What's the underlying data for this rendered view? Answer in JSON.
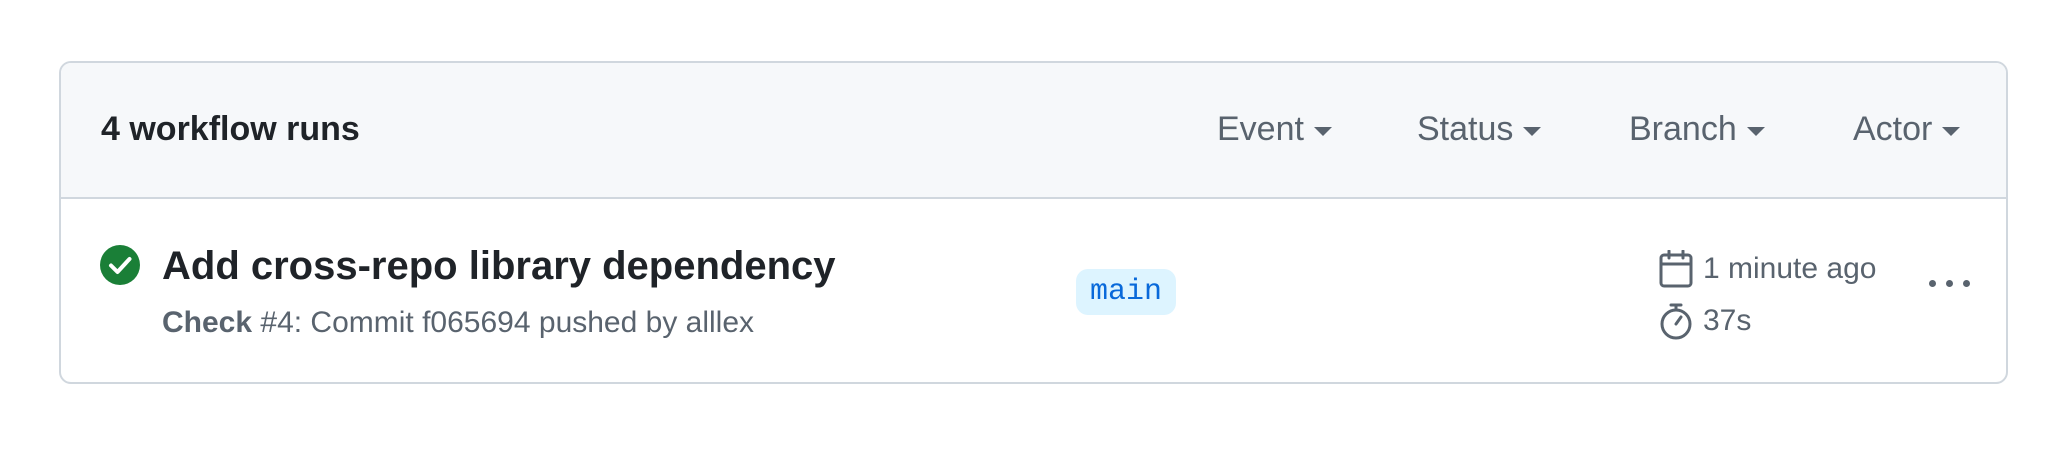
{
  "header": {
    "runs_count": "4 workflow runs",
    "filters": {
      "event": "Event",
      "status": "Status",
      "branch": "Branch",
      "actor": "Actor"
    }
  },
  "runs": [
    {
      "status_icon": "check-circle-icon",
      "status_color": "#1a7f37",
      "title": "Add cross-repo library dependency",
      "workflow_name": "Check",
      "run_number": "#4",
      "description": ": Commit f065694 pushed by alllex",
      "branch": "main",
      "time_icon": "calendar-icon",
      "time_ago": "1 minute ago",
      "duration_icon": "stopwatch-icon",
      "duration": "37s",
      "menu_icon": "kebab-horizontal-icon"
    }
  ]
}
